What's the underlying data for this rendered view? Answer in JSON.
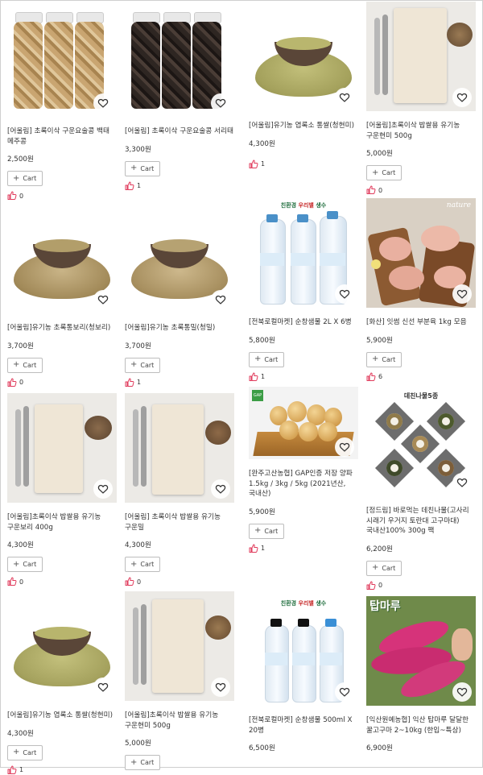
{
  "colors": {
    "heart": "#333333",
    "thumb": "#e03a5b",
    "border": "#bdbdbd"
  },
  "icons": {
    "wishlist": "heart-outline-icon",
    "like": "thumbs-up-icon",
    "cart": "plus-icon"
  },
  "cart_label": "Cart",
  "columns": [
    [
      {
        "name": "[어울림] 초록이삭 구운요술콩 백태 메주콩",
        "price": "2,500원",
        "likes": "0"
      },
      {
        "name": "[어울림]유기농 초록통보리(청보리)",
        "price": "3,700원",
        "likes": "0"
      },
      {
        "name": "[어울림]초록이삭 밥쌀용 유기농 구운보리 400g",
        "price": "4,300원",
        "likes": "0"
      },
      {
        "name": "[어울림]유기농 엽록소 통쌀(청현미)",
        "price": "4,300원",
        "likes": "1"
      }
    ],
    [
      {
        "name": "[어울림] 초록이삭 구운요술콩 서리태",
        "price": "3,300원",
        "likes": "1"
      },
      {
        "name": "[어울림]유기농 초록통밀(청밀)",
        "price": "3,700원",
        "likes": "1"
      },
      {
        "name": "[어울림] 초록이삭 밥쌀용 유기농 구운밀",
        "price": "4,300원",
        "likes": "0"
      },
      {
        "name": "[어울림]초록이삭 밥쌀용 유기농 구운현미 500g",
        "price": "5,000원",
        "likes": ""
      }
    ],
    [
      {
        "name": "[어울림]유기농 엽록소 통쌀(청현미)",
        "price": "4,300원",
        "likes": "1"
      },
      {
        "name": "[전북로컬마켓] 순창샘물 2L X 6병",
        "price": "5,800원",
        "likes": "1",
        "banner_green": "친환경 ",
        "banner_red": "우리밸 ",
        "banner_end": "생수"
      },
      {
        "name": "[완주고산농협] GAP인증 저장 양파 1.5kg / 3kg / 5kg (2021년산,국내산)",
        "price": "5,900원",
        "likes": "1",
        "badge": "GAP"
      },
      {
        "name": "[전북로컬마켓] 순창샘물 500ml X 20병",
        "price": "6,500원",
        "likes": "",
        "banner_green": "친환경 ",
        "banner_red": "우리밸 ",
        "banner_end": "생수"
      }
    ],
    [
      {
        "name": "[어울림]초록이삭 밥쌀용 유기농 구운현미 500g",
        "price": "5,000원",
        "likes": "0"
      },
      {
        "name": "[화산] 잇썸 신선 부분육 1kg 모음",
        "price": "5,900원",
        "likes": "6",
        "brand": "nature"
      },
      {
        "name": "[정드림] 바로먹는 데친나물(고사리 시래기 우거지 토란대 고구마대)국내산100% 300g 팩",
        "price": "6,200원",
        "likes": "0",
        "banner": "데친나물5종"
      },
      {
        "name": "[익산원예농협] 익산 탑마루 달달한 꿀고구마 2~10kg (한입~특상)",
        "price": "6,900원",
        "likes": "",
        "brand": "탑마루"
      }
    ]
  ]
}
